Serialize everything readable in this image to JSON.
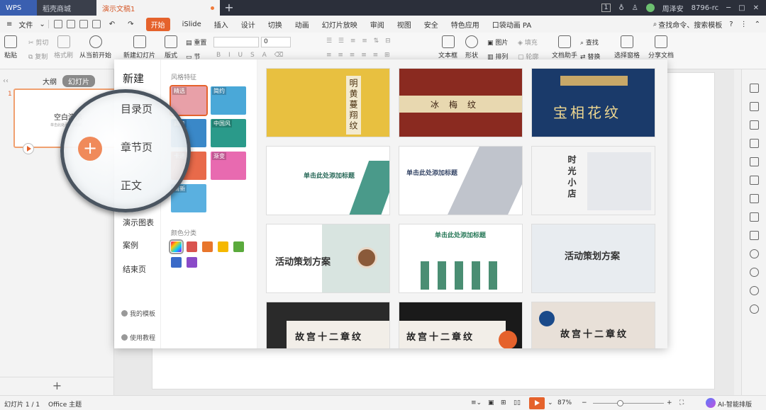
{
  "titlebar": {
    "tabs": [
      "WPS",
      "稻壳商城",
      "演示文稿1"
    ],
    "user_name": "周泽安",
    "user_badge": "1",
    "account": "8796-rc"
  },
  "menubar": {
    "file": "文件",
    "items": [
      "开始",
      "iSlide",
      "插入",
      "设计",
      "切换",
      "动画",
      "幻灯片放映",
      "审阅",
      "视图",
      "安全",
      "特色应用",
      "口袋动画 PA"
    ],
    "search": "查找命令、搜索模板"
  },
  "ribbon": {
    "paste": "粘贴",
    "cut": "剪切",
    "copy": "复制",
    "format_painter": "格式刷",
    "from_current": "从当前开始",
    "new_slide": "新建幻灯片",
    "layout": "版式",
    "reset": "重置",
    "section": "节",
    "font_size": "0",
    "textbox": "文本框",
    "shape": "形状",
    "picture": "图片",
    "fill": "填充",
    "arrange": "排列",
    "outline": "轮廓",
    "doc_assistant": "文档助手",
    "find": "查找",
    "replace": "替换",
    "select_pane": "选择窗格",
    "share_doc": "分享文档"
  },
  "left_panel": {
    "tab_outline": "大纲",
    "tab_slides": "幻灯片",
    "slide_number": "1",
    "slide_title": "空白演示",
    "slide_subtitle": "单击此处添加副标题"
  },
  "popup": {
    "title": "新建",
    "categories": [
      "目录页",
      "章节页",
      "正文",
      "演示图表",
      "案例",
      "结束页"
    ],
    "my_templates": "我的模板",
    "tutorial": "使用教程",
    "style_label": "风格特征",
    "color_label": "颜色分类",
    "styles": [
      {
        "name": "精选",
        "color": "#e8a0a8"
      },
      {
        "name": "简约",
        "color": "#4aa8d8"
      },
      {
        "name": "商务",
        "color": "#3a88c8"
      },
      {
        "name": "中国风",
        "color": "#2a9a8a"
      },
      {
        "name": "卡通",
        "color": "#e86a4a"
      },
      {
        "name": "渐变",
        "color": "#e86ab0"
      },
      {
        "name": "清新",
        "color": "#5ab0e0"
      }
    ],
    "colors": [
      "rainbow",
      "#d9534f",
      "#e8762c",
      "#f5b800",
      "#5aaa3c",
      "#3a6ac8",
      "#8a4ac8"
    ],
    "templates": [
      {
        "title": "明黄蔓翔纹",
        "bg": "#e8c040",
        "fg": "#4a3010"
      },
      {
        "title": "冰梅纹",
        "bg": "#8a2a20",
        "fg": "#3a2010"
      },
      {
        "title": "宝相花纹",
        "bg": "#1a3a6a",
        "fg": "#f0d890"
      },
      {
        "title": "单击此处添加标题",
        "bg": "#ffffff",
        "fg": "#2a6a5a"
      },
      {
        "title": "单击此处添加标题",
        "bg": "#ffffff",
        "fg": "#3a4a6a"
      },
      {
        "title": "时光小店",
        "bg": "#f4f4f4",
        "fg": "#333333"
      },
      {
        "title": "活动策划方案",
        "bg": "#ffffff",
        "fg": "#333333"
      },
      {
        "title": "单击此处添加标题",
        "bg": "#ffffff",
        "fg": "#2a7a5a"
      },
      {
        "title": "活动策划方案",
        "bg": "#e8ecf0",
        "fg": "#333333"
      },
      {
        "title": "故宫十二章纹",
        "bg": "#2a2a2a",
        "fg": "#222222"
      },
      {
        "title": "故宫十二章纹",
        "bg": "#1a1a1a",
        "fg": "#222222"
      },
      {
        "title": "故宫十二章纹",
        "bg": "#e8e0d8",
        "fg": "#222222"
      }
    ]
  },
  "magnifier": {
    "items": [
      "目录页",
      "章节页",
      "正文"
    ],
    "plus": "+"
  },
  "statusbar": {
    "slide_info": "幻灯片 1 / 1",
    "theme": "Office 主题",
    "zoom": "87%",
    "zoom_level": 0.38,
    "ai_layout": "AI-智能排版"
  },
  "accent": "#e5622c"
}
